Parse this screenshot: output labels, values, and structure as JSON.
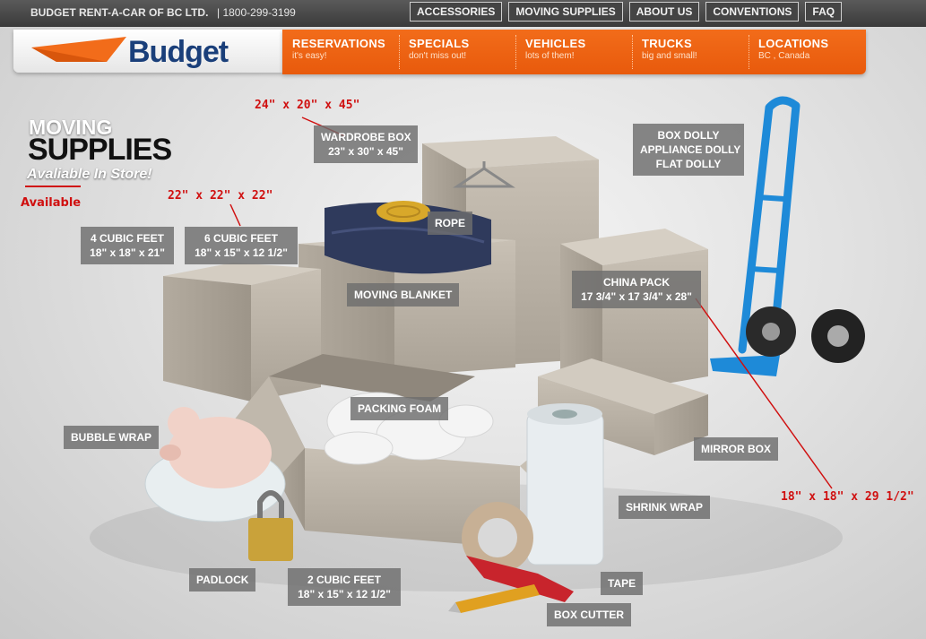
{
  "header": {
    "company": "BUDGET RENT-A-CAR OF BC LTD.",
    "phone": "| 1800-299-3199",
    "links": [
      "ACCESSORIES",
      "MOVING SUPPLIES",
      "ABOUT US",
      "CONVENTIONS",
      "FAQ"
    ]
  },
  "logo": {
    "text": "Budget"
  },
  "nav": [
    {
      "title": "RESERVATIONS",
      "sub": "it's easy!"
    },
    {
      "title": "SPECIALS",
      "sub": "don't miss out!"
    },
    {
      "title": "VEHICLES",
      "sub": "lots of them!"
    },
    {
      "title": "TRUCKS",
      "sub": "big and small!"
    },
    {
      "title": "LOCATIONS",
      "sub": "BC , Canada"
    }
  ],
  "heading": {
    "line1": "MOVING",
    "line2": "SUPPLIES",
    "line3": "Avaliable In Store!"
  },
  "annotations": {
    "available": "Available",
    "wardrobe_size": "24\" x 20\" x 45\"",
    "six_cubic_size": "22\" x 22\" x 22\"",
    "china_size": "18\" x 18\" x 29 1/2\""
  },
  "labels": {
    "wardrobe_title": "WARDROBE BOX",
    "wardrobe_dims": "23\" x 30\" x 45\"",
    "dolly1": "BOX DOLLY",
    "dolly2": "APPLIANCE DOLLY",
    "dolly3": "FLAT DOLLY",
    "four_cubic_title": "4 CUBIC FEET",
    "four_cubic_dims": "18\" x 18\" x 21\"",
    "six_cubic_title": "6 CUBIC FEET",
    "six_cubic_dims": "18\" x 15\" x 12 1/2\"",
    "rope": "ROPE",
    "blanket": "MOVING BLANKET",
    "china_title": "CHINA PACK",
    "china_dims": "17 3/4\" x 17 3/4\" x 28\"",
    "foam": "PACKING FOAM",
    "bubble": "BUBBLE WRAP",
    "mirror": "MIRROR BOX",
    "shrink": "SHRINK WRAP",
    "padlock": "PADLOCK",
    "two_cubic_title": "2 CUBIC FEET",
    "two_cubic_dims": "18\" x 15\" x 12 1/2\"",
    "tape": "TAPE",
    "cutter": "BOX CUTTER"
  },
  "colors": {
    "brand_orange": "#f26c1a",
    "brand_blue": "#1a3f7a",
    "annotation_red": "#d01010"
  }
}
